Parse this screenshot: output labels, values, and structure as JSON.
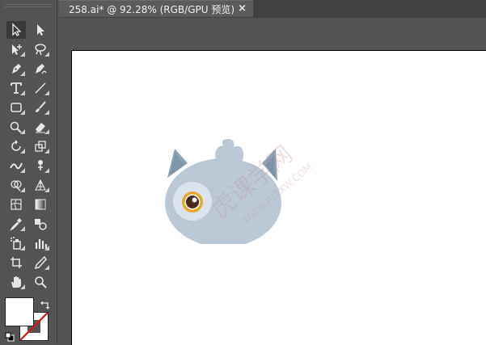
{
  "document_tab": {
    "title": "258.ai* @ 92.28% (RGB/GPU 预览)",
    "close_glyph": "×"
  },
  "watermark": {
    "text": "虎课学网",
    "url": "WWW.RJZXW.COM"
  },
  "toolbar": {
    "tools": [
      "selection-tool",
      "direct-selection-tool",
      "group-selection-tool",
      "lasso-tool",
      "pen-tool",
      "curvature-tool",
      "type-tool",
      "line-segment-tool",
      "rectangle-tool",
      "paintbrush-tool",
      "shaper-tool",
      "eraser-tool",
      "rotate-tool",
      "scale-tool",
      "width-tool",
      "puppet-warp-tool",
      "shape-builder-tool",
      "perspective-grid-tool",
      "mesh-tool",
      "gradient-tool",
      "eyedropper-tool",
      "blend-tool",
      "symbol-sprayer-tool",
      "column-graph-tool",
      "artboard-tool",
      "slice-tool",
      "hand-tool",
      "zoom-tool"
    ],
    "fill_color": "#ffffff",
    "stroke": "none"
  },
  "colors": {
    "ui_bg": "#535353",
    "tab_active": "#5b5b5b",
    "head_fill": "#bac8d6",
    "ear_fill": "#8aa2b2",
    "eye_ring": "#e8a829"
  }
}
